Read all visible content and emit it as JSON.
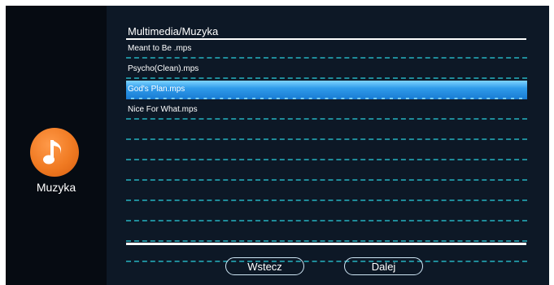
{
  "sidebar": {
    "app_label": "Muzyka",
    "icon": "music-note-icon",
    "icon_color": "#f07a22"
  },
  "main": {
    "title": "Multimedia/Muzyka",
    "tracks": [
      "Meant to Be .mps",
      "Psycho(Clean).mps",
      "God's Plan.mps",
      "Nice For What.mps",
      "",
      "",
      "",
      "",
      "",
      "",
      ""
    ],
    "selected_index": 2
  },
  "buttons": {
    "back_label": "Wstecz",
    "next_label": "Dalej"
  },
  "colors": {
    "selected": "#2f9bea",
    "divider": "#1f8c9a"
  }
}
